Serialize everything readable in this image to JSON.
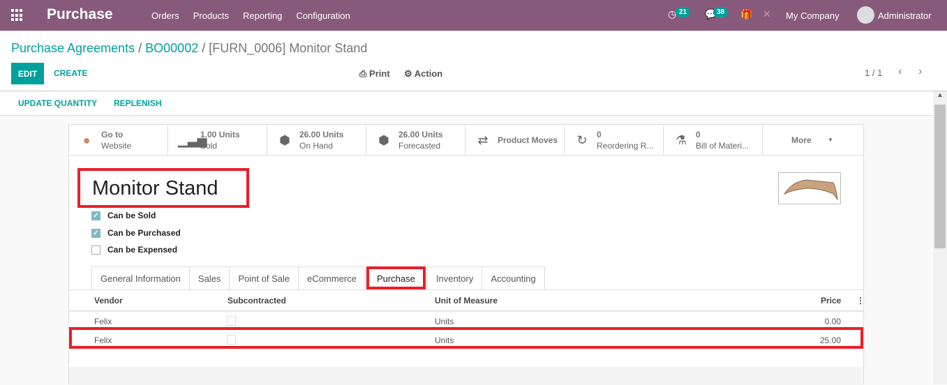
{
  "navbar": {
    "app_title": "Purchase",
    "menu": [
      "Orders",
      "Products",
      "Reporting",
      "Configuration"
    ],
    "activity_count": "21",
    "message_count": "38",
    "company": "My Company",
    "user": "Administrator"
  },
  "breadcrumb": {
    "items": [
      "Purchase Agreements",
      "BO00002"
    ],
    "current": "[FURN_0006] Monitor Stand",
    "separator": "/"
  },
  "toolbar": {
    "edit": "EDIT",
    "create": "CREATE",
    "print": "Print",
    "action": "Action",
    "pager": "1 / 1"
  },
  "statusbar": {
    "update_quantity": "UPDATE QUANTITY",
    "replenish": "REPLENISH"
  },
  "smart_buttons": [
    {
      "line1": "Go to",
      "line2": "Website",
      "icon": "globe-icon"
    },
    {
      "line1": "1.00 Units",
      "line2": "Sold",
      "icon": "signal-icon"
    },
    {
      "line1": "26.00 Units",
      "line2": "On Hand",
      "icon": "cubes-icon"
    },
    {
      "line1": "26.00 Units",
      "line2": "Forecasted",
      "icon": "cubes-icon"
    },
    {
      "line1": "Product Moves",
      "line2": "",
      "icon": "exchange-icon"
    },
    {
      "line1": "0",
      "line2": "Reordering R...",
      "icon": "refresh-icon"
    },
    {
      "line1": "0",
      "line2": "Bill of Materi...",
      "icon": "flask-icon"
    },
    {
      "line1": "More",
      "line2": "",
      "icon": "caret-down-icon"
    }
  ],
  "product": {
    "name": "Monitor Stand",
    "can_be_sold": {
      "label": "Can be Sold",
      "checked": true
    },
    "can_be_purchased": {
      "label": "Can be Purchased",
      "checked": true
    },
    "can_be_expensed": {
      "label": "Can be Expensed",
      "checked": false
    }
  },
  "tabs": [
    "General Information",
    "Sales",
    "Point of Sale",
    "eCommerce",
    "Purchase",
    "Inventory",
    "Accounting"
  ],
  "active_tab": "Purchase",
  "vendor_table": {
    "headers": [
      "Vendor",
      "Subcontracted",
      "Unit of Measure",
      "Price"
    ],
    "rows": [
      {
        "vendor": "Felix",
        "subcontracted": false,
        "uom": "Units",
        "price": "0.00"
      },
      {
        "vendor": "Felix",
        "subcontracted": false,
        "uom": "Units",
        "price": "25.00"
      }
    ]
  },
  "colors": {
    "brand": "#875A7B",
    "accent": "#00A09D",
    "highlight": "#E8202A"
  }
}
